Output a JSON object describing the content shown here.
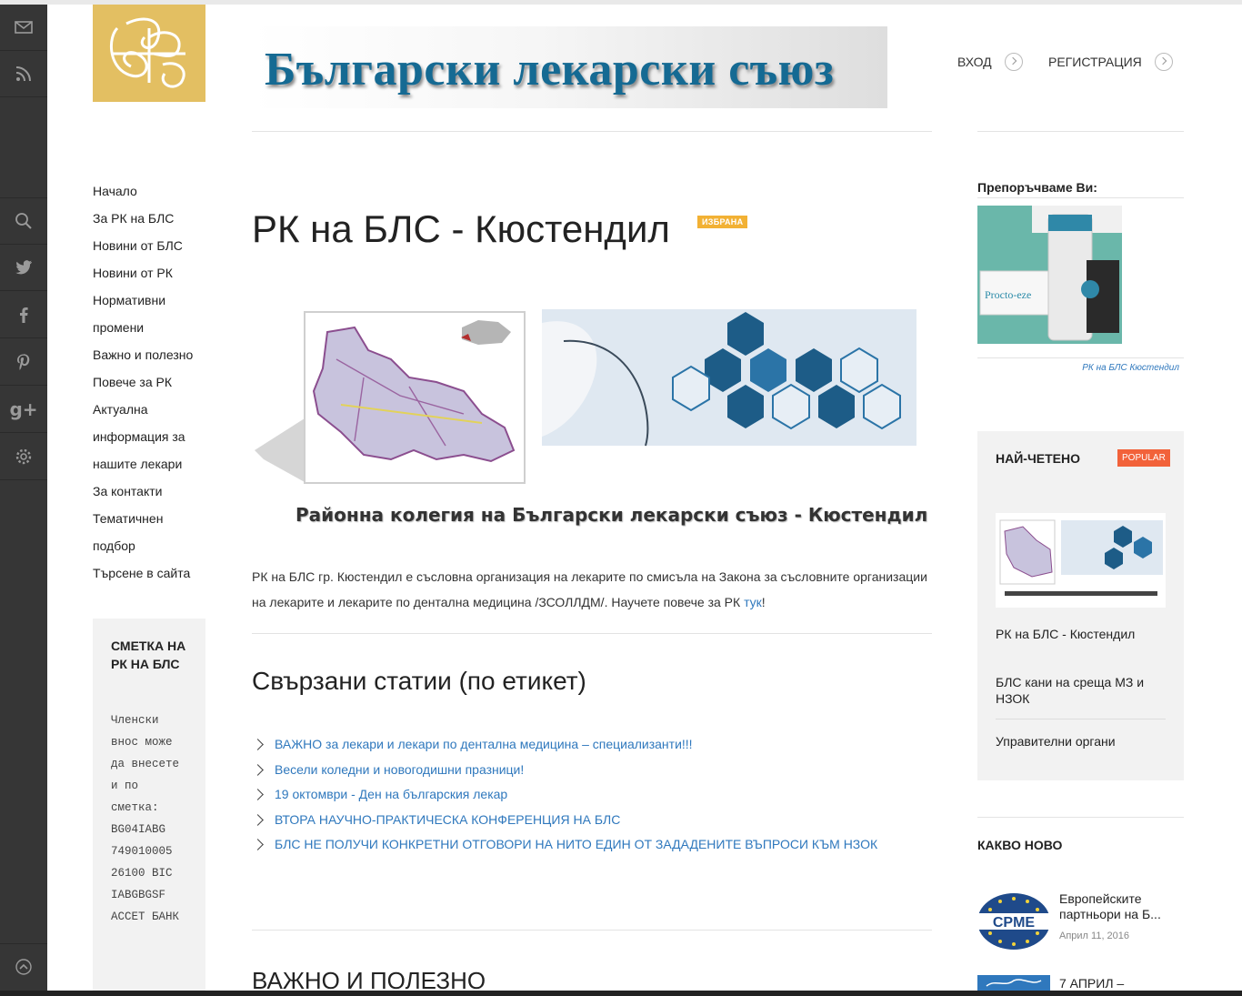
{
  "site": {
    "banner_title": "Български лекарски съюз",
    "login_label": "ВХОД",
    "register_label": "РЕГИСТРАЦИЯ"
  },
  "rail_icons": [
    "mail-icon",
    "rss-icon",
    "search-icon",
    "twitter-icon",
    "facebook-icon",
    "pinterest-icon",
    "googleplus-icon",
    "settings-icon",
    "scroll-top-icon"
  ],
  "nav": {
    "items": [
      "Начало",
      "За РК на БЛС",
      "Новини от БЛС",
      "Новини от РК",
      "Нормативни",
      "промени",
      "Важно и полезно",
      "Повече за РК",
      "Актуална",
      "информация за",
      "нашите лекари",
      "За контакти",
      "Тематичнен",
      "подбор",
      "Търсене в сайта"
    ]
  },
  "account": {
    "title": "СМЕТКА НА РК НА БЛС",
    "body": "Членски внос може да внесете и по сметка: BG04IABG 749010005 26100 BIC IABGBGSF АССЕТ БАНК"
  },
  "article": {
    "title": "РК на БЛС - Кюстендил",
    "badge": "ИЗБРАНА",
    "image_caption": "Районна колегия на Български лекарски съюз - Кюстендил",
    "text": "РК на БЛС гр. Кюстендил е съсловна организация на лекарите по смисъла на Закона за съсловните организации на лекарите и лекарите по дентална медицина /ЗСОЛЛДМ/. Научете повече за РК ",
    "link": "тук",
    "text_end": "!"
  },
  "related": {
    "title": "Свързани статии (по етикет)",
    "items": [
      "ВАЖНО за лекари и лекари по дентална медицина – специализанти!!!",
      "Весели коледни и новогодишни празници!",
      "19 октомври - Ден на българския лекар",
      "ВТОРА НАУЧНО-ПРАКТИЧЕСКА КОНФЕРЕНЦИЯ НА БЛС",
      "БЛС НЕ ПОЛУЧИ КОНКРЕТНИ ОТГОВОРИ НА НИТО ЕДИН ОТ ЗАДАДЕНИТЕ ВЪПРОСИ КЪМ НЗОК"
    ]
  },
  "section2_title": "ВАЖНО И ПОЛЕЗНО",
  "sidebar": {
    "recommend_title": "Препоръчваме Ви:",
    "ad_brand": "Procto-eze",
    "ad_link": "РК на БЛС Кюстендил",
    "popular_title": "НАЙ-ЧЕТЕНО",
    "popular_badge": "POPULAR",
    "popular_items": [
      "РК на БЛС - Кюстендил",
      "БЛС кани на среща МЗ и НЗОК",
      "Управителни органи"
    ],
    "new_title": "КАКВО НОВО",
    "news": [
      {
        "title": "Европейските партньори на Б...",
        "date": "Април 11, 2016",
        "thumb_text": "CPME"
      },
      {
        "title": "7 АПРИЛ –",
        "date": ""
      }
    ]
  }
}
